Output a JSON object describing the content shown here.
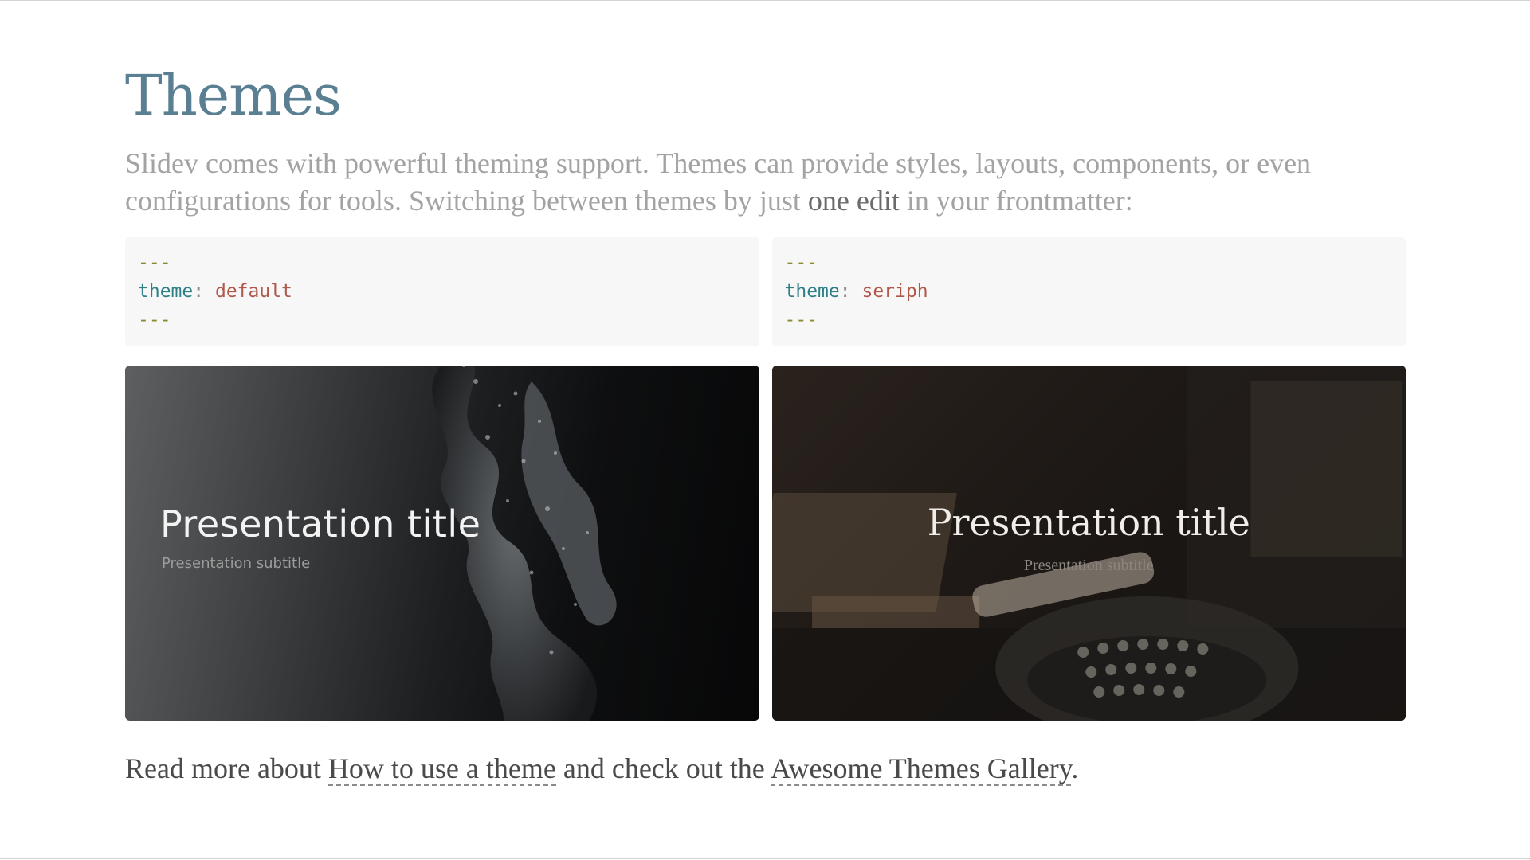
{
  "slide": {
    "title": "Themes",
    "intro": {
      "part1": "Slidev comes with powerful theming support. Themes can provide styles, layouts, components, or even configurations for tools. Switching between themes by just ",
      "emphasis": "one edit",
      "part2": " in your frontmatter:"
    },
    "code_blocks": [
      {
        "dash_open": "---",
        "key": "theme",
        "colon": ":",
        "value": "default",
        "dash_close": "---"
      },
      {
        "dash_open": "---",
        "key": "theme",
        "colon": ":",
        "value": "seriph",
        "dash_close": "---"
      }
    ],
    "previews": [
      {
        "theme": "default",
        "title": "Presentation title",
        "subtitle": "Presentation subtitle"
      },
      {
        "theme": "seriph",
        "title": "Presentation title",
        "subtitle": "Presentation subtitle"
      }
    ],
    "footer": {
      "prefix": "Read more about ",
      "link1": "How to use a theme",
      "middle": " and check out the ",
      "link2": "Awesome Themes Gallery",
      "suffix": "."
    }
  },
  "colors": {
    "heading": "#5a7f92",
    "intro_text": "#a3a3a3",
    "code_key": "#2f7f86",
    "code_value": "#b0594b",
    "code_dash": "#8a8a2e",
    "code_bg": "#f7f7f7"
  }
}
